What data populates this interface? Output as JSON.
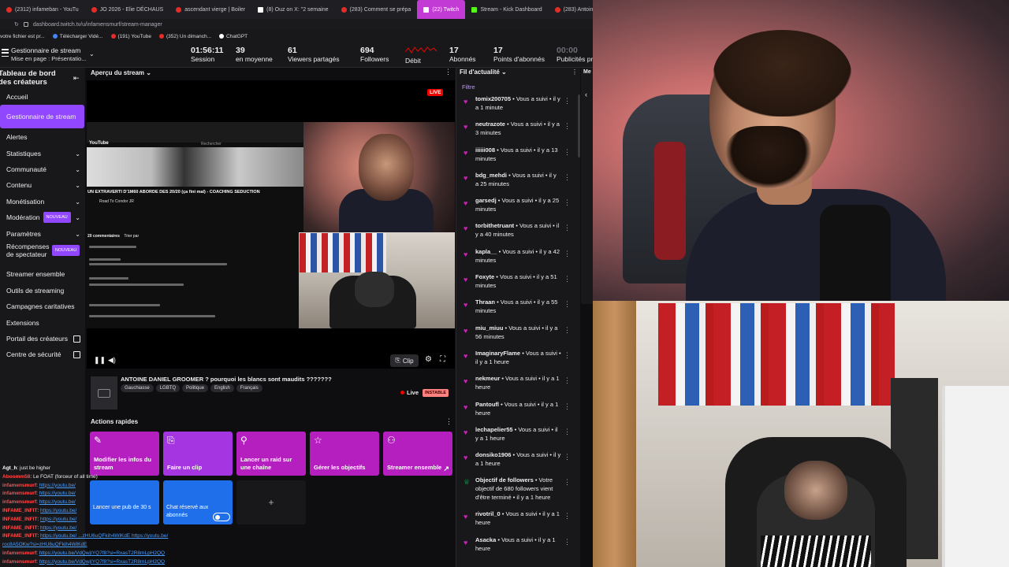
{
  "browser": {
    "tabs": [
      {
        "label": "(2312) infameban - YouTu",
        "icon": "youtube-icon"
      },
      {
        "label": "JO 2026 - Elie DÉCHAUS",
        "icon": "youtube-icon"
      },
      {
        "label": "ascendant vierge | Boiler",
        "icon": "youtube-icon"
      },
      {
        "label": "(8) Ouz on X: \"2 semaine",
        "icon": "x-icon"
      },
      {
        "label": "(283) Comment se prépa",
        "icon": "youtube-icon"
      },
      {
        "label": "(22) Twitch",
        "icon": "twitch-icon",
        "active": true
      },
      {
        "label": "Stream - Kick Dashboard",
        "icon": "kick-icon"
      },
      {
        "label": "(283) Antoine",
        "icon": "youtube-icon"
      }
    ],
    "url": "dashboard.twitch.tv/u/infamensmurf/stream-manager",
    "bookmarks": [
      {
        "label": "votre fichier est pr...",
        "icon": "folder-icon"
      },
      {
        "label": "Télécharger Vidé...",
        "icon": "download-icon"
      },
      {
        "label": "(191) YouTube",
        "icon": "youtube-icon"
      },
      {
        "label": "(352) Un dimanch...",
        "icon": "youtube-icon"
      },
      {
        "label": "ChatGPT",
        "icon": "chatgpt-icon"
      }
    ]
  },
  "topbar": {
    "title": "Gestionnaire de stream",
    "subtitle": "Mise en page : Présentatio...",
    "stats": [
      {
        "value": "01:56:11",
        "label": "Session"
      },
      {
        "value": "39",
        "label": "en moyenne"
      },
      {
        "value": "61",
        "label": "Viewers partagés"
      },
      {
        "value": "694",
        "label": "Followers"
      },
      {
        "value": "",
        "label": "Débit"
      },
      {
        "value": "17",
        "label": "Abonnés"
      },
      {
        "value": "17",
        "label": "Points d'abonnés"
      },
      {
        "value": "00:00",
        "label": "Publicités pr"
      }
    ]
  },
  "sidebar": {
    "heading": "Tableau de bord des créateurs",
    "items": [
      {
        "label": "Accueil"
      },
      {
        "label": "Gestionnaire de stream",
        "active": true
      },
      {
        "label": "Alertes"
      },
      {
        "label": "Statistiques",
        "expandable": true
      },
      {
        "label": "Communauté",
        "expandable": true
      },
      {
        "label": "Contenu",
        "expandable": true
      },
      {
        "label": "Monétisation",
        "expandable": true
      },
      {
        "label": "Modération",
        "badge": "NOUVEAU",
        "expandable": true
      },
      {
        "label": "Paramètres",
        "expandable": true
      },
      {
        "label": "Récompenses de spectateur",
        "badge": "NOUVEAU"
      },
      {
        "label": "Streamer ensemble"
      },
      {
        "label": "Outils de streaming"
      },
      {
        "label": "Campagnes caritatives"
      },
      {
        "label": "Extensions"
      },
      {
        "label": "Portail des créateurs",
        "external": true
      },
      {
        "label": "Centre de sécurité",
        "external": true
      }
    ]
  },
  "preview": {
    "header": "Aperçu du stream",
    "live_badge": "LIVE",
    "clip_label": "Clip",
    "youtube": {
      "logo": "YouTube",
      "search_placeholder": "Rechercher",
      "video_title": "UN EXTRAVERTI D'1M60 ABORDE DES 20/20 (ça fini mal) - COACHING SEDUCTION",
      "channel": "Road To Condor JR",
      "comments_header": "20 commentaires",
      "sort_label": "Trier par"
    },
    "stream_title": "ANTOINE DANIEL GROOMER ? pourquoi les blancs sont maudits ???????",
    "tags": [
      "Gauchiasse",
      "LGBTQ",
      "Politique",
      "English",
      "Français"
    ],
    "live_label": "Live",
    "stability": "INSTABLE"
  },
  "quick_actions": {
    "header": "Actions rapides",
    "items": [
      {
        "label": "Modifier les infos du stream",
        "icon": "pencil-icon",
        "color": "#b51fbf"
      },
      {
        "label": "Faire un clip",
        "icon": "clip-icon",
        "color": "#a435e0"
      },
      {
        "label": "Lancer un raid sur une chaîne",
        "icon": "raid-icon",
        "color": "#b51fbf"
      },
      {
        "label": "Gérer les objectifs",
        "icon": "star-icon",
        "color": "#b51fbf"
      },
      {
        "label": "Streamer ensemble",
        "icon": "add-user-icon",
        "color": "#b51fbf",
        "external": true
      }
    ],
    "ad_label": "Lancer une pub de 30 s",
    "sub_label": "Chat réservé aux abonnés"
  },
  "chat": [
    {
      "user": "Agt_h",
      "text": " just be higher",
      "user_color": "#ffffff"
    },
    {
      "user": "Aboomm58",
      "text": " Le FOAT (forceur of all time)",
      "user_color": "#ff4b4b"
    },
    {
      "user": "infamensmurf",
      "link": "https://youtu.be/",
      "user_color": "#ff4b4b"
    },
    {
      "user": "infamensmurf",
      "link": "https://youtu.be/",
      "user_color": "#ff4b4b"
    },
    {
      "user": "infamensmurf",
      "link": "https://youtu.be/",
      "user_color": "#ff4b4b"
    },
    {
      "user": "INFAME_INFIT",
      "link": "https://youtu.be/",
      "user_color": "#ff4b4b"
    },
    {
      "user": "INFAME_INFIT",
      "link": "https://youtu.be/",
      "user_color": "#ff4b4b"
    },
    {
      "user": "INFAME_INFIT",
      "link": "https://youtu.be/",
      "user_color": "#ff4b4b"
    },
    {
      "user": "INFAME_INFIT",
      "link": "https://youtu.be/ ...zHU6uQFkih4WiKdE https://youtu.be/",
      "user_color": "#ff4b4b"
    },
    {
      "user": "",
      "link": "roc8A5OKw?si=zHU6uQFkih4WiKdE",
      "user_color": "#ff4b4b"
    },
    {
      "user": "infamensmurf",
      "link": "https://youtu.be/VdQwjIYQ7f8?si=RxasT2R8mLpH2QQ",
      "user_color": "#ff4b4b"
    },
    {
      "user": "infamensmurf",
      "link": "https://youtu.be/VdQwjIYQ7f8?si=RxasT2R8mLpH2QQ",
      "user_color": "#ff4b4b"
    },
    {
      "user": "infamensmurf",
      "link": "https://youtu.be/VdQwjIYQ7f8?si=RxasT2R8mLpH2QQ",
      "user_color": "#ff4b4b"
    }
  ],
  "feed": {
    "header": "Fil d'actualité",
    "filter": "Filtre",
    "items": [
      {
        "name": "tomix200705",
        "text": " • Vous a suivi • il y a 1 minute"
      },
      {
        "name": "neutrazote",
        "text": " • Vous a suivi • il y a 3 minutes"
      },
      {
        "name": "iiiiii008",
        "text": " • Vous a suivi • il y a 13 minutes"
      },
      {
        "name": "bdg_mehdi",
        "text": " • Vous a suivi • il y a 25 minutes"
      },
      {
        "name": "garsedj",
        "text": " • Vous a suivi • il y a 25 minutes"
      },
      {
        "name": "torbithetruant",
        "text": " • Vous a suivi • il y a 40 minutes"
      },
      {
        "name": "kapla__",
        "text": " • Vous a suivi • il y a 42 minutes"
      },
      {
        "name": "Foxyte",
        "text": " • Vous a suivi • il y a 51 minutes"
      },
      {
        "name": "Thraan",
        "text": " • Vous a suivi • il y a 55 minutes"
      },
      {
        "name": "miu_miuu",
        "text": " • Vous a suivi • il y a 56 minutes"
      },
      {
        "name": "ImaginaryFlame",
        "text": " • Vous a suivi • il y a 1 heure"
      },
      {
        "name": "nekmeur",
        "text": " • Vous a suivi • il y a 1 heure"
      },
      {
        "name": "Pantoufl",
        "text": " • Vous a suivi • il y a 1 heure"
      },
      {
        "name": "lechapelier55",
        "text": " • Vous a suivi • il y a 1 heure"
      },
      {
        "name": "donsiko1906",
        "text": " • Vous a suivi • il y a 1 heure"
      },
      {
        "name": "Objectif de followers",
        "text": " • Votre objectif de 680 followers vient d'être terminé • il y a 1 heure",
        "type": "goal"
      },
      {
        "name": "rivotril_0",
        "text": " • Vous a suivi • il y a 1 heure"
      },
      {
        "name": "Asacka",
        "text": " • Vous a suivi • il y a 1 heure"
      }
    ]
  },
  "right_panel_label": "Me",
  "colors": {
    "accent": "#9147ff",
    "live": "#eb0400",
    "follow_heart": "#d31ebf"
  }
}
